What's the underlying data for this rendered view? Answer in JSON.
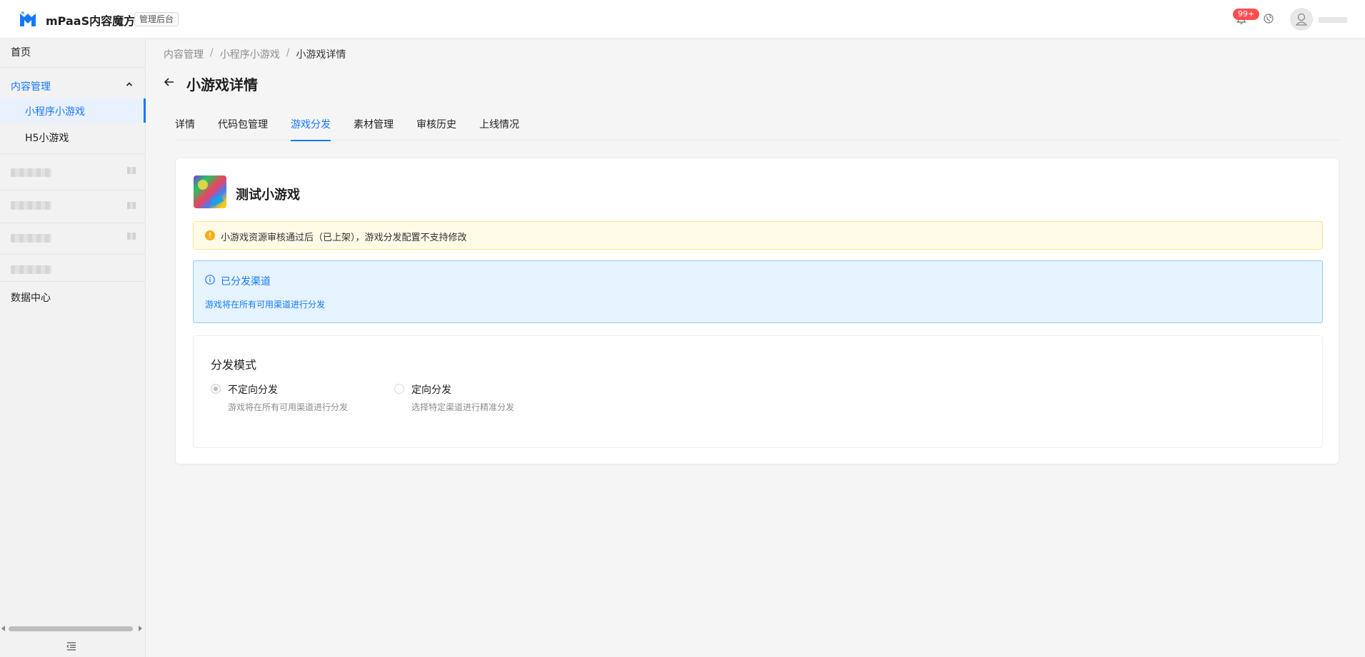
{
  "header": {
    "app_title": "mPaaS内容魔方",
    "admin_tag": "管理后台",
    "notification_badge": "99+",
    "brand_color": "#1677ff"
  },
  "sidebar": {
    "home": "首页",
    "content_mgmt": "内容管理",
    "sub_items": [
      "小程序小游戏",
      "H5小游戏"
    ],
    "data_center": "数据中心"
  },
  "breadcrumb": [
    "内容管理",
    "小程序小游戏",
    "小游戏详情"
  ],
  "breadcrumb_sep": "/",
  "page_title": "小游戏详情",
  "tabs": [
    "详情",
    "代码包管理",
    "游戏分发",
    "素材管理",
    "审核历史",
    "上线情况"
  ],
  "active_tab": "游戏分发",
  "game": {
    "name": "测试小游戏"
  },
  "warning": {
    "text": "小游戏资源审核通过后（已上架），游戏分发配置不支持修改"
  },
  "info": {
    "title": "已分发渠道",
    "desc": "游戏将在所有可用渠道进行分发"
  },
  "distribution": {
    "title": "分发模式",
    "options": [
      {
        "label": "不定向分发",
        "desc": "游戏将在所有可用渠道进行分发",
        "checked": true
      },
      {
        "label": "定向分发",
        "desc": "选择特定渠道进行精准分发",
        "checked": false
      }
    ]
  }
}
